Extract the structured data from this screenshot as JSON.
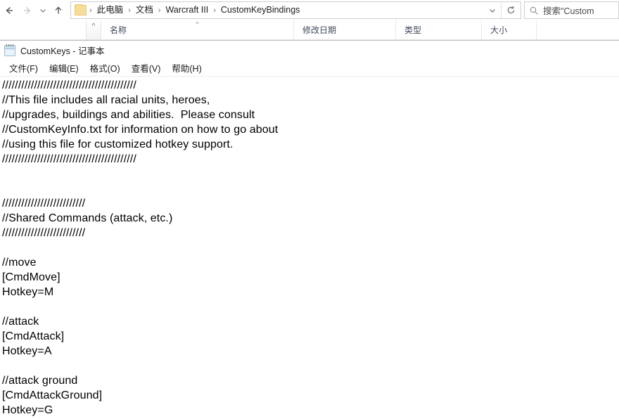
{
  "explorer": {
    "nav": {
      "back_label": "←",
      "forward_label": "→",
      "recent_label": "⌄",
      "up_label": "↑"
    },
    "breadcrumb": {
      "folder_icon": "folder-icon",
      "items": [
        "此电脑",
        "文档",
        "Warcraft III",
        "CustomKeyBindings"
      ],
      "separator": "›"
    },
    "address_controls": {
      "dropdown_label": "⌄",
      "refresh_label": "refresh-icon"
    },
    "search": {
      "icon": "search-icon",
      "text": "搜索\"Custom"
    },
    "columns": {
      "sort_caret": "^",
      "headers": [
        "名称",
        "修改日期",
        "类型",
        "大小"
      ]
    }
  },
  "notepad": {
    "icon": "notepad-icon",
    "title": "CustomKeys - 记事本",
    "menu": [
      "文件(F)",
      "编辑(E)",
      "格式(O)",
      "查看(V)",
      "帮助(H)"
    ],
    "lines": [
      "//////////////////////////////////////////",
      "//This file includes all racial units, heroes,",
      "//upgrades, buildings and abilities.  Please consult",
      "//CustomKeyInfo.txt for information on how to go about",
      "//using this file for customized hotkey support.",
      "//////////////////////////////////////////",
      "",
      "",
      "//////////////////////////",
      "//Shared Commands (attack, etc.)",
      "//////////////////////////",
      "",
      "//move",
      "[CmdMove]",
      "Hotkey=M",
      "",
      "//attack",
      "[CmdAttack]",
      "Hotkey=A",
      "",
      "//attack ground",
      "[CmdAttackGround]",
      "Hotkey=G"
    ]
  }
}
